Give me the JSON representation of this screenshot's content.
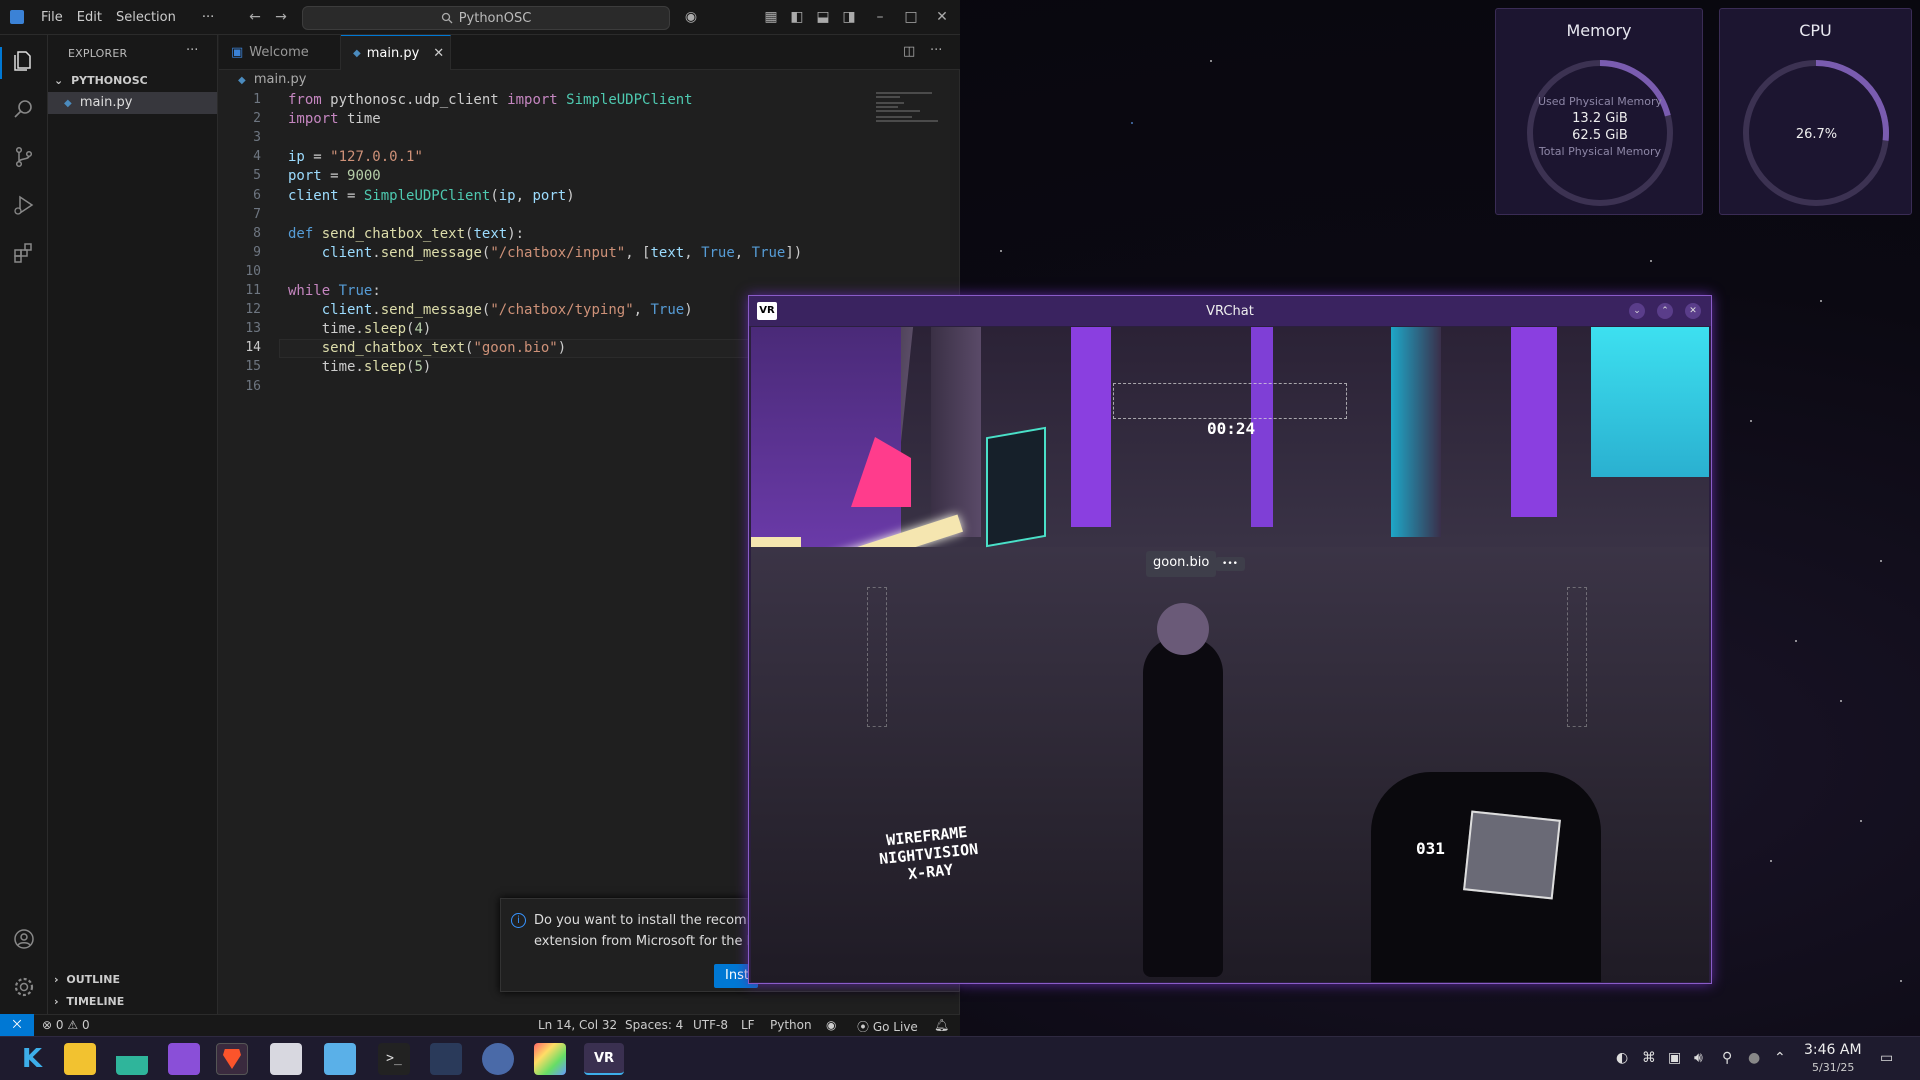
{
  "vscode": {
    "menu": [
      "File",
      "Edit",
      "Selection",
      "···"
    ],
    "command_center": "PythonOSC",
    "explorer_title": "EXPLORER",
    "explorer_more": "···",
    "folder": "PYTHONOSC",
    "file": "main.py",
    "tabs": [
      {
        "label": "Welcome",
        "active": false
      },
      {
        "label": "main.py",
        "active": true
      }
    ],
    "breadcrumb": "main.py",
    "lines": [
      {
        "n": "1",
        "tokens": [
          [
            "kw",
            "from"
          ],
          [
            "tx",
            " pythonosc.udp_client "
          ],
          [
            "kw",
            "import"
          ],
          [
            "tx",
            " "
          ],
          [
            "ty",
            "SimpleUDPClient"
          ]
        ]
      },
      {
        "n": "2",
        "tokens": [
          [
            "kw",
            "import"
          ],
          [
            "tx",
            " time"
          ]
        ]
      },
      {
        "n": "3",
        "tokens": []
      },
      {
        "n": "4",
        "tokens": [
          [
            "va",
            "ip"
          ],
          [
            "tx",
            " = "
          ],
          [
            "st",
            "\"127.0.0.1\""
          ]
        ]
      },
      {
        "n": "5",
        "tokens": [
          [
            "va",
            "port"
          ],
          [
            "tx",
            " = "
          ],
          [
            "nu",
            "9000"
          ]
        ]
      },
      {
        "n": "6",
        "tokens": [
          [
            "va",
            "client"
          ],
          [
            "tx",
            " = "
          ],
          [
            "ty",
            "SimpleUDPClient"
          ],
          [
            "tx",
            "("
          ],
          [
            "va",
            "ip"
          ],
          [
            "tx",
            ", "
          ],
          [
            "va",
            "port"
          ],
          [
            "tx",
            ")"
          ]
        ]
      },
      {
        "n": "7",
        "tokens": []
      },
      {
        "n": "8",
        "tokens": [
          [
            "bl",
            "def"
          ],
          [
            "tx",
            " "
          ],
          [
            "fn",
            "send_chatbox_text"
          ],
          [
            "tx",
            "("
          ],
          [
            "va",
            "text"
          ],
          [
            "tx",
            "):"
          ]
        ]
      },
      {
        "n": "9",
        "tokens": [
          [
            "tx",
            "    "
          ],
          [
            "va",
            "client"
          ],
          [
            "tx",
            "."
          ],
          [
            "fn",
            "send_message"
          ],
          [
            "tx",
            "("
          ],
          [
            "st",
            "\"/chatbox/input\""
          ],
          [
            "tx",
            ", ["
          ],
          [
            "va",
            "text"
          ],
          [
            "tx",
            ", "
          ],
          [
            "bl",
            "True"
          ],
          [
            "tx",
            ", "
          ],
          [
            "bl",
            "True"
          ],
          [
            "tx",
            "])"
          ]
        ]
      },
      {
        "n": "10",
        "tokens": []
      },
      {
        "n": "11",
        "tokens": [
          [
            "kw",
            "while"
          ],
          [
            "tx",
            " "
          ],
          [
            "bl",
            "True"
          ],
          [
            "tx",
            ":"
          ]
        ]
      },
      {
        "n": "12",
        "tokens": [
          [
            "tx",
            "    "
          ],
          [
            "va",
            "client"
          ],
          [
            "tx",
            "."
          ],
          [
            "fn",
            "send_message"
          ],
          [
            "tx",
            "("
          ],
          [
            "st",
            "\"/chatbox/typing\""
          ],
          [
            "tx",
            ", "
          ],
          [
            "bl",
            "True"
          ],
          [
            "tx",
            ")"
          ]
        ]
      },
      {
        "n": "13",
        "tokens": [
          [
            "tx",
            "    time."
          ],
          [
            "fn",
            "sleep"
          ],
          [
            "tx",
            "("
          ],
          [
            "nu",
            "4"
          ],
          [
            "tx",
            ")"
          ]
        ]
      },
      {
        "n": "14",
        "tokens": [
          [
            "tx",
            "    "
          ],
          [
            "fn",
            "send_chatbox_text"
          ],
          [
            "tx",
            "("
          ],
          [
            "st",
            "\"goon.bio\""
          ],
          [
            "tx",
            ")"
          ]
        ]
      },
      {
        "n": "15",
        "tokens": [
          [
            "tx",
            "    time."
          ],
          [
            "fn",
            "sleep"
          ],
          [
            "tx",
            "("
          ],
          [
            "nu",
            "5"
          ],
          [
            "tx",
            ")"
          ]
        ]
      },
      {
        "n": "16",
        "tokens": []
      }
    ],
    "current_line": "14",
    "outline": "OUTLINE",
    "timeline": "TIMELINE",
    "notification": {
      "line1": "Do you want to install the recomme",
      "line2": "extension from Microsoft for the Py",
      "button": "Inst"
    },
    "status": {
      "errors": "0",
      "warnings": "0",
      "position": "Ln 14, Col 32",
      "spaces": "Spaces: 4",
      "encoding": "UTF-8",
      "eol": "LF",
      "language": "Python",
      "golive": "Go Live"
    }
  },
  "widgets": {
    "memory": {
      "title": "Memory",
      "used_label": "Used Physical Memory",
      "used": "13.2 GiB",
      "total": "62.5 GiB",
      "total_label": "Total Physical Memory",
      "used_fraction": 0.21
    },
    "cpu": {
      "title": "CPU",
      "value": "26.7%",
      "fraction": 0.267
    }
  },
  "vrchat": {
    "title": "VRChat",
    "logo": "VR",
    "timer": "00:24",
    "chatbox": "goon.bio",
    "typing": "•••",
    "modes": [
      "WIREFRAME",
      "NIGHTVISION",
      "X-RAY"
    ],
    "hud_number": "031"
  },
  "clock": {
    "time": "3:46 AM",
    "date": "5/31/25"
  },
  "colors": {
    "accent": "#0078d4",
    "vr_border": "#8a5cc8",
    "panel": "#1c1530"
  }
}
